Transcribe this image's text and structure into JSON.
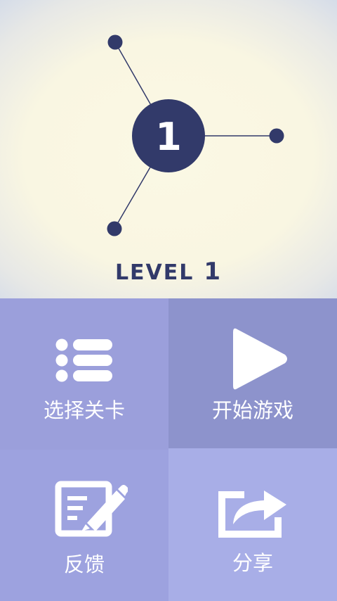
{
  "game": {
    "level_number": "1",
    "level_label": "LEVEL",
    "level_value": "1"
  },
  "menu": {
    "select_level": "选择关卡",
    "start_game": "开始游戏",
    "feedback": "反馈",
    "share": "分享"
  },
  "colors": {
    "navy": "#323a6a",
    "hero_bg": "#fbf8e4",
    "tile_select": "#9b9fdb",
    "tile_start": "#8d93cc",
    "tile_feedback": "#9da2df",
    "tile_share": "#a8aee7"
  },
  "icons": {
    "select_level": "list-icon",
    "start_game": "play-icon",
    "feedback": "edit-icon",
    "share": "share-icon"
  }
}
